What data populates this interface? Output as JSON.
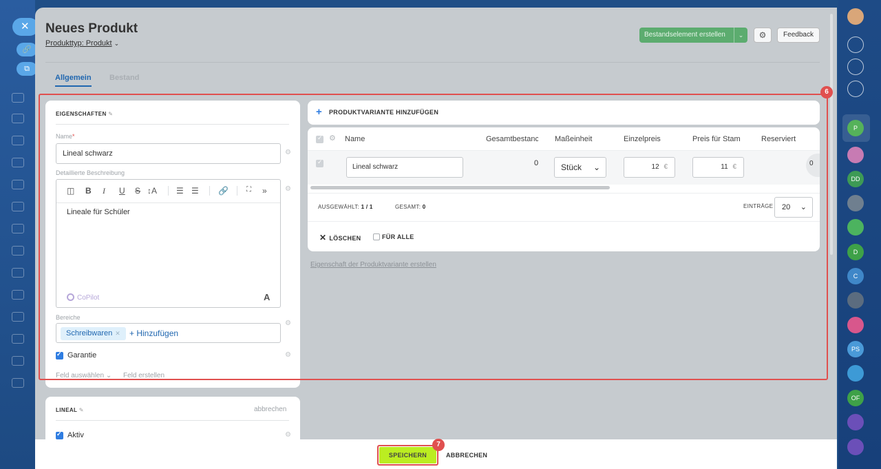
{
  "header": {
    "title": "Neues Produkt",
    "product_type": "Produkttyp: Produkt",
    "create_stock_btn": "Bestandselement erstellen",
    "feedback_btn": "Feedback"
  },
  "tabs": [
    {
      "label": "Allgemein",
      "active": true
    },
    {
      "label": "Bestand",
      "active": false
    }
  ],
  "properties": {
    "title": "EIGENSCHAFTEN",
    "name_label": "Name",
    "name_value": "Lineal schwarz",
    "desc_label": "Detaillierte Beschreibung",
    "desc_value": "Lineale für Schüler",
    "copilot": "CoPilot",
    "sections_label": "Bereiche",
    "section_tag": "Schreibwaren",
    "add_section": "+ Hinzufügen",
    "warranty": "Garantie",
    "select_field": "Feld auswählen",
    "create_field": "Feld erstellen"
  },
  "lineal_card": {
    "title": "LINEAL",
    "cancel": "abbrechen",
    "active": "Aktiv"
  },
  "variants": {
    "add_label": "PRODUKTVARIANTE HINZUFÜGEN",
    "columns": [
      "Name",
      "Gesamtbestanc",
      "Maßeinheit",
      "Einzelpreis",
      "Preis für Stam",
      "Reserviert"
    ],
    "row": {
      "name": "Lineal schwarz",
      "total_stock": "0",
      "unit": "Stück",
      "price": "12",
      "price_currency": "€",
      "base_price": "11",
      "base_currency": "€",
      "reserved": "0"
    },
    "selected": "AUSGEWÄHLT:",
    "selected_value": "1 / 1",
    "total": "GESAMT:",
    "total_value": "0",
    "entries": "EINTRÄGE",
    "entries_value": "20",
    "delete": "LÖSCHEN",
    "for_all": "FÜR ALLE",
    "create_variant_property": "Eigenschaft der Produktvariante erstellen"
  },
  "footer": {
    "save": "SPEICHERN",
    "cancel": "ABBRECHEN"
  },
  "badges": {
    "highlight": "6",
    "save": "7"
  },
  "right_sidebar": [
    "P",
    "DD",
    "D",
    "C",
    "PS",
    "OF"
  ],
  "colors": {
    "accent_blue": "#2067b0",
    "save_green": "#bbed21",
    "highlight_red": "#e0504f",
    "create_button_green": "#5cac6f"
  },
  "icons": [
    "close-icon",
    "link-icon",
    "external-link-icon",
    "gear-icon",
    "pencil-icon",
    "bell-icon",
    "search-icon"
  ]
}
